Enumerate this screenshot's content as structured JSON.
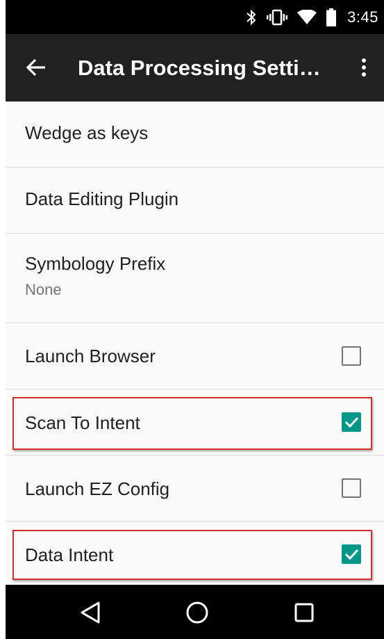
{
  "status_bar": {
    "icons": [
      "bluetooth-icon",
      "vibrate-icon",
      "wifi-icon",
      "battery-icon"
    ],
    "time": "3:45"
  },
  "app_bar": {
    "back_icon": "arrow-back-icon",
    "title": "Data Processing Setti…",
    "overflow_icon": "more-vert-icon"
  },
  "list": {
    "items": [
      {
        "title": "Wedge as keys"
      },
      {
        "title": "Data Editing Plugin"
      },
      {
        "title": "Symbology Prefix",
        "summary": "None"
      },
      {
        "title": "Launch Browser",
        "checked": false
      },
      {
        "title": "Scan To Intent",
        "checked": true,
        "highlighted": true
      },
      {
        "title": "Launch EZ Config",
        "checked": false
      },
      {
        "title": "Data Intent",
        "checked": true,
        "highlighted": true
      }
    ]
  },
  "nav_bar": {
    "icons": [
      "back-triangle-icon",
      "home-circle-icon",
      "recents-square-icon"
    ]
  },
  "colors": {
    "app_bar": "#212121",
    "accent": "#009688",
    "highlight_border": "#d32f2f",
    "background": "#fafafa"
  }
}
